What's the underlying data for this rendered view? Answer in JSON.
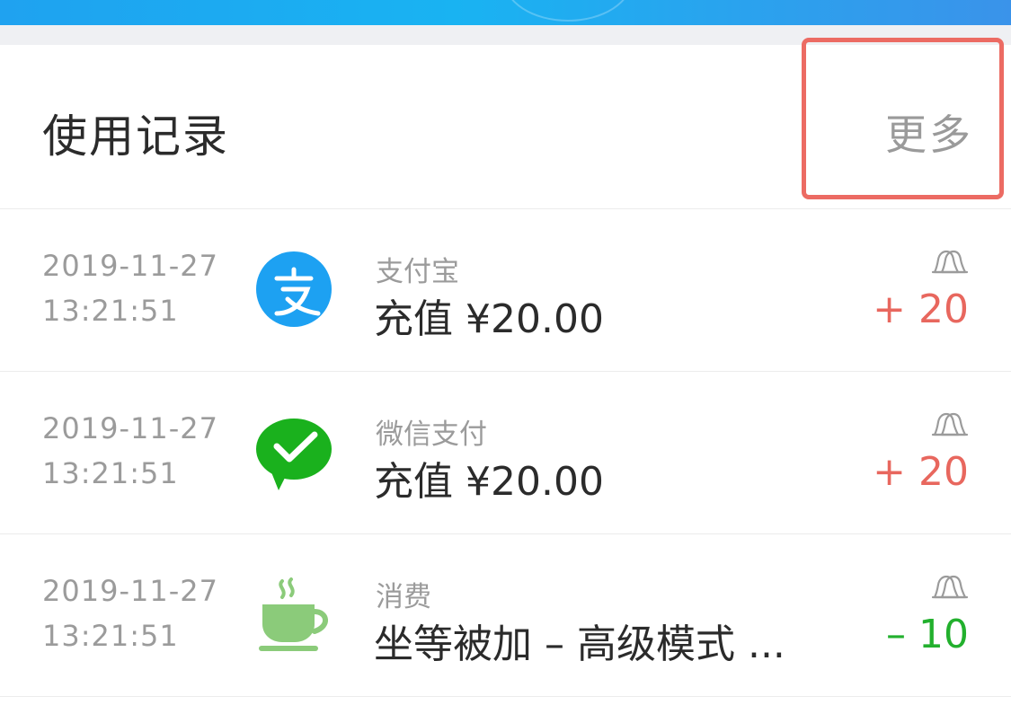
{
  "header": {
    "title": "使用记录",
    "more_label": "更多"
  },
  "records": [
    {
      "date": "2019-11-27",
      "time": "13:21:51",
      "source": "支付宝",
      "description": "充值 ¥20.00",
      "amount": "+ 20",
      "icon": "alipay-icon"
    },
    {
      "date": "2019-11-27",
      "time": "13:21:51",
      "source": "微信支付",
      "description": "充值 ¥20.00",
      "amount": "+ 20",
      "icon": "wechat-pay-icon"
    },
    {
      "date": "2019-11-27",
      "time": "13:21:51",
      "source": "消费",
      "description": "坐等被加 – 高级模式 ...",
      "amount": "– 10",
      "icon": "coffee-cup-icon"
    }
  ],
  "colors": {
    "banner": "#1fa2f0",
    "highlight": "#ec6b63",
    "amount_plus": "#e8675e",
    "amount_minus": "#22b02d",
    "alipay": "#1da1f2",
    "wechat": "#1ab11d",
    "coffee": "#8bcb7a"
  }
}
